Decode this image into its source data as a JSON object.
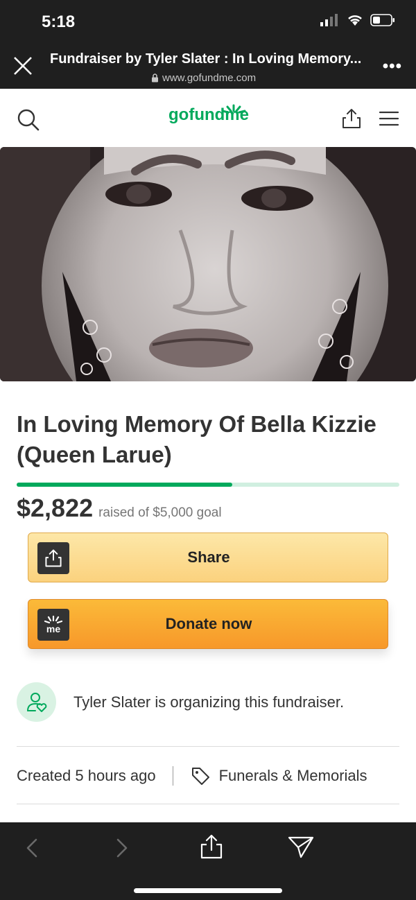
{
  "status_bar": {
    "time": "5:18"
  },
  "browser": {
    "page_title": "Fundraiser by Tyler Slater : In Loving Memory...",
    "url": "www.gofundme.com"
  },
  "site_header": {
    "logo": "gofundme"
  },
  "campaign": {
    "title": "In Loving Memory Of Bella Kizzie (Queen Larue)",
    "raised": "$2,822",
    "goal_text": "raised of $5,000 goal",
    "progress_percent": 56.4
  },
  "actions": {
    "share_label": "Share",
    "donate_label": "Donate now",
    "donate_icon_text": "me"
  },
  "organizer": {
    "text": "Tyler Slater is organizing this fundraiser."
  },
  "meta": {
    "created": "Created 5 hours ago",
    "category": "Funerals & Memorials"
  },
  "colors": {
    "brand": "#02a95c",
    "donate": "#f7982a",
    "share": "#fbd27e"
  },
  "icons": [
    "close-icon",
    "lock-icon",
    "more-icon",
    "search-icon",
    "share-icon",
    "menu-icon",
    "tag-icon",
    "person-heart-icon",
    "back-icon",
    "forward-icon",
    "send-icon"
  ]
}
